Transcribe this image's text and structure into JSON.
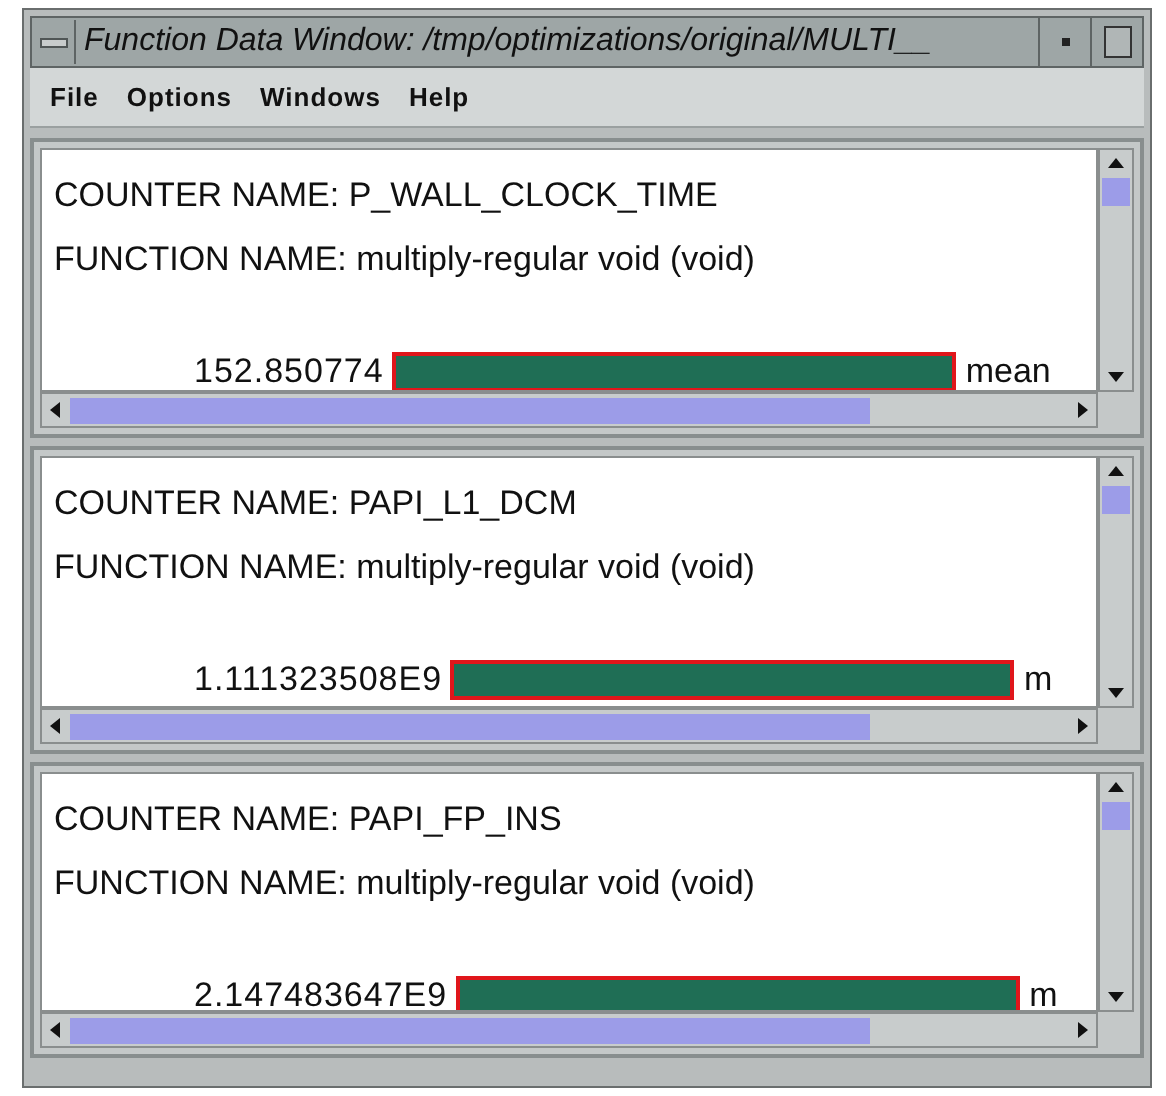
{
  "window": {
    "title": "Function Data Window: /tmp/optimizations/original/MULTI__"
  },
  "menu": [
    "File",
    "Options",
    "Windows",
    "Help"
  ],
  "panels": [
    {
      "counter_line": "COUNTER NAME: P_WALL_CLOCK_TIME",
      "function_line": "FUNCTION NAME: multiply-regular void (void)",
      "value": "152.850774",
      "bar_label": "mean"
    },
    {
      "counter_line": "COUNTER NAME: PAPI_L1_DCM",
      "function_line": "FUNCTION NAME: multiply-regular void (void)",
      "value": "1.111323508E9",
      "bar_label": "m"
    },
    {
      "counter_line": "COUNTER NAME: PAPI_FP_INS",
      "function_line": "FUNCTION NAME: multiply-regular void (void)",
      "value": "2.147483647E9",
      "bar_label": "m"
    }
  ]
}
